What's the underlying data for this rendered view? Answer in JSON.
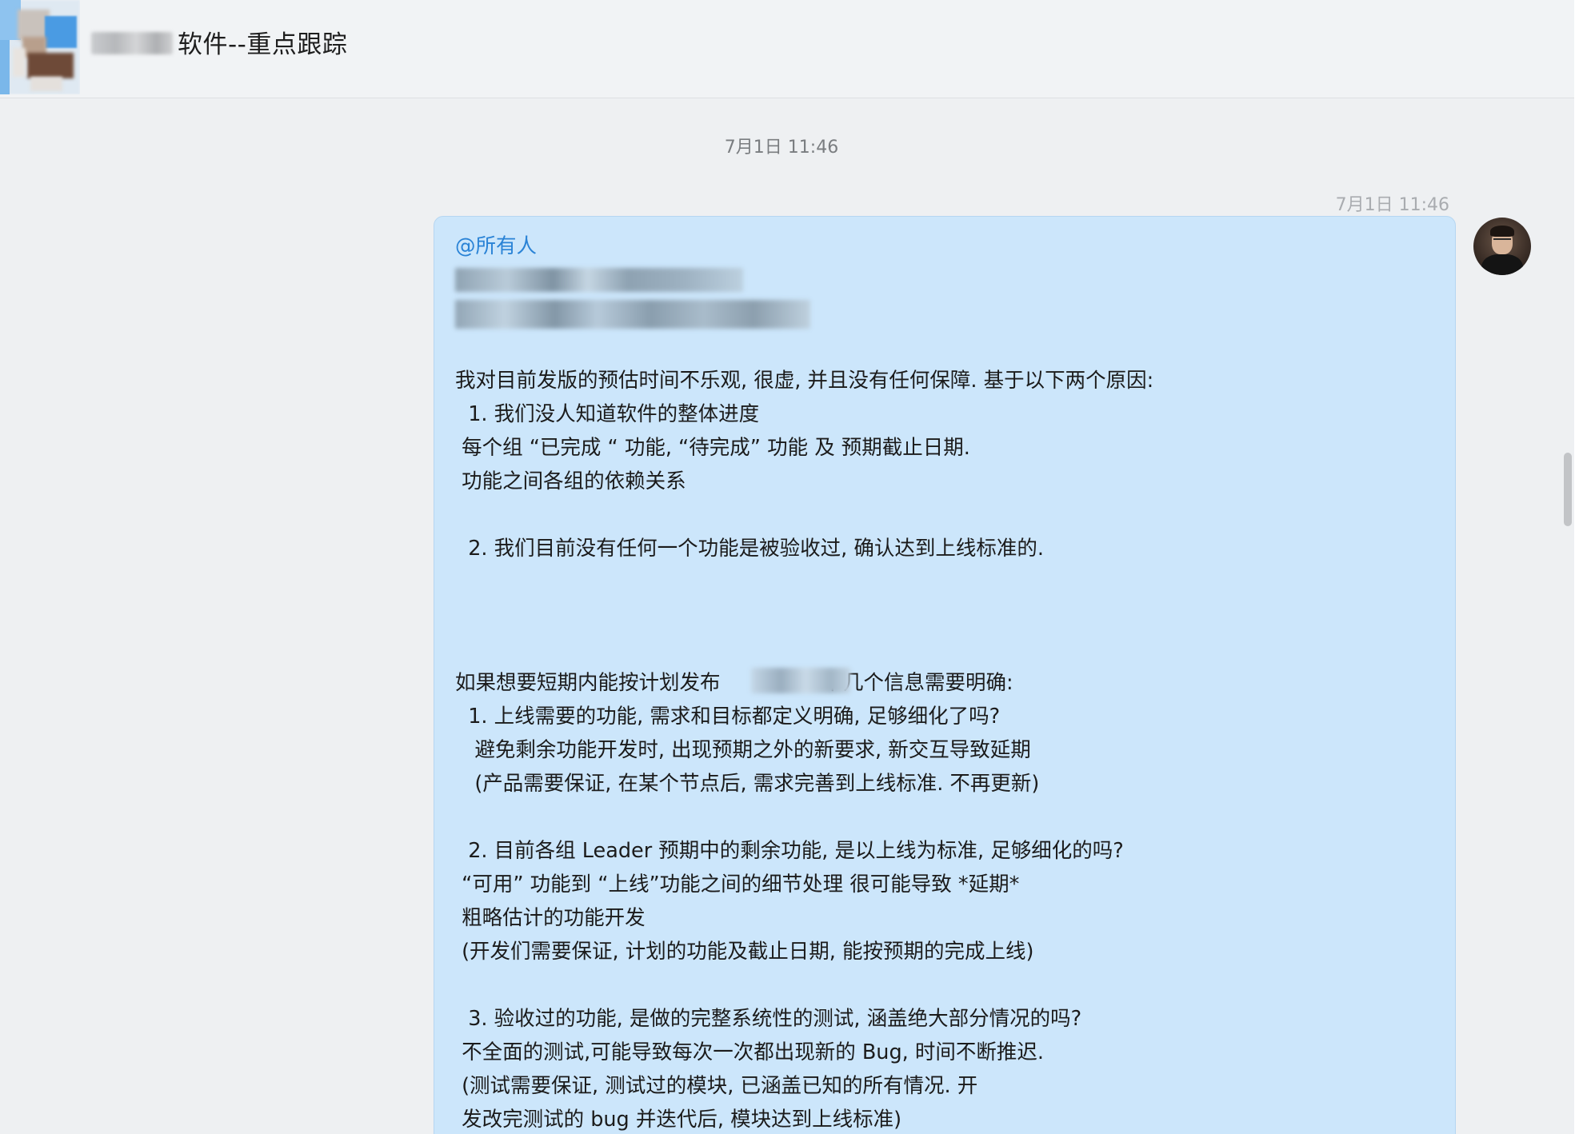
{
  "header": {
    "group_title": "软件--重点跟踪"
  },
  "conversation": {
    "time_divider": "7月1日 11:46",
    "message": {
      "time": "7月1日 11:46",
      "mention": "@所有人",
      "lines": [
        "我对目前发版的预估时间不乐观, 很虚, 并且没有任何保障. 基于以下两个原因:",
        "  1. 我们没人知道软件的整体进度",
        " 每个组 “已完成 “ 功能, “待完成” 功能 及 预期截止日期.",
        " 功能之间各组的依赖关系",
        "",
        "  2. 我们目前没有任何一个功能是被验收过, 确认达到上线标准的.",
        "",
        "",
        "",
        "",
        "  1. 上线需要的功能, 需求和目标都定义明确, 足够细化了吗?",
        "   避免剩余功能开发时, 出现预期之外的新要求, 新交互导致延期",
        "   (产品需要保证, 在某个节点后, 需求完善到上线标准. 不再更新)",
        "",
        "  2. 目前各组 Leader 预期中的剩余功能, 是以上线为标准, 足够细化的吗?",
        " “可用” 功能到 “上线”功能之间的细节处理 很可能导致 *延期*",
        " 粗略估计的功能开发",
        " (开发们需要保证, 计划的功能及截止日期, 能按预期的完成上线)",
        "",
        "  3. 验收过的功能, 是做的完整系统性的测试, 涵盖绝大部分情况的吗?",
        " 不全面的测试,可能导致每次一次都出现新的 Bug, 时间不断推迟.",
        " (测试需要保证, 测试过的模块, 已涵盖已知的所有情况. 开",
        " 发改完测试的 bug 并迭代后, 模块达到上线标准)"
      ],
      "release_line_prefix": "如果想要短期内能按计划发布",
      "release_line_suffix": "下几个信息需要明确:"
    }
  },
  "colors": {
    "bubble_bg": "#cce6fb",
    "mention": "#2a83d6",
    "page_bg": "#eef0f2"
  }
}
